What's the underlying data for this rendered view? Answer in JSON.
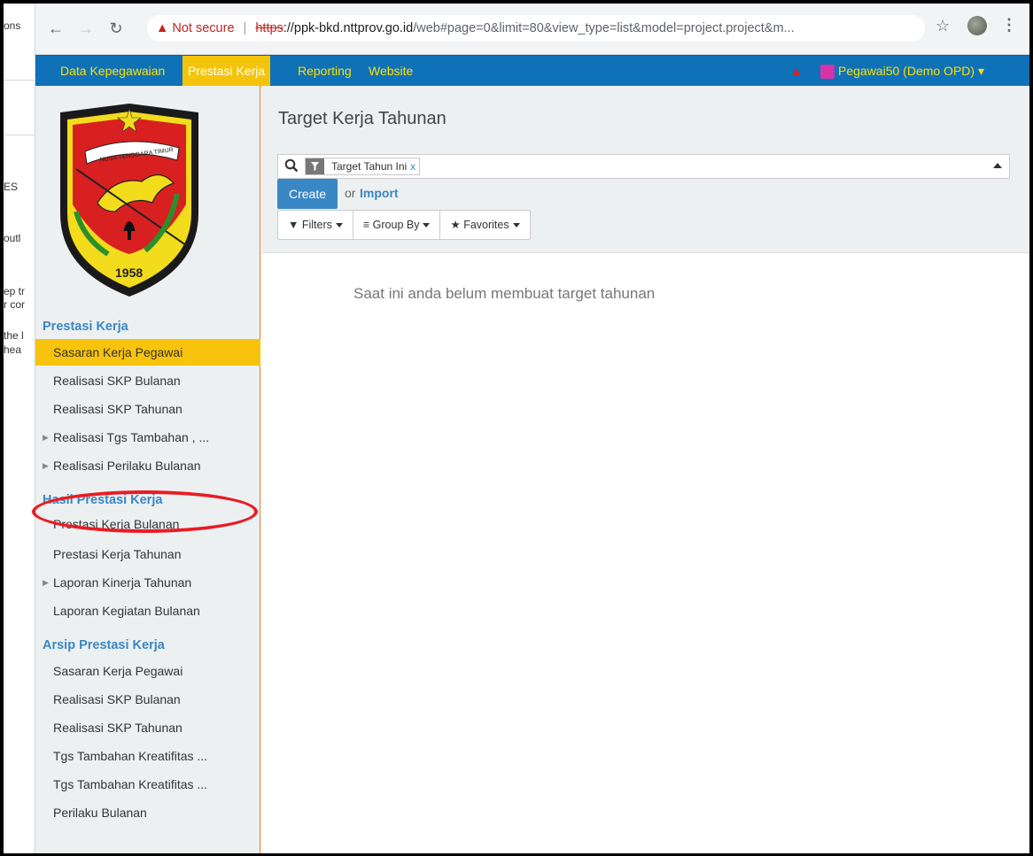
{
  "left_pane": {
    "fragments": [
      "ons",
      "ES",
      "outl",
      "ep tr",
      "r cor",
      "the l",
      "hea"
    ]
  },
  "browser": {
    "security_label": "Not secure",
    "url_scheme": "https",
    "url_host": "://ppk-bkd.nttprov.go.id",
    "url_path": "/web#page=0&limit=80&view_type=list&model=project.project&m..."
  },
  "topnav": {
    "items": [
      "Data Kepegawaian",
      "Prestasi Kerja",
      "Reporting",
      "Website"
    ],
    "active": "Prestasi Kerja",
    "user": "Pegawai50 (Demo OPD)"
  },
  "sidebar": {
    "logo_banner": "NUSA TENGGARA TIMUR",
    "logo_year": "1958",
    "sections": [
      {
        "title": "Prestasi Kerja",
        "items": [
          "Sasaran Kerja Pegawai",
          "Realisasi SKP Bulanan",
          "Realisasi SKP Tahunan",
          "Realisasi Tgs Tambahan , ...",
          "Realisasi Perilaku Bulanan"
        ]
      },
      {
        "title": "Hasil Prestasi Kerja",
        "items": [
          "Prestasi Kerja Bulanan",
          "Prestasi Kerja Tahunan",
          "Laporan Kinerja Tahunan",
          "Laporan Kegiatan Bulanan"
        ]
      },
      {
        "title": "Arsip Prestasi Kerja",
        "items": [
          "Sasaran Kerja Pegawai",
          "Realisasi SKP Bulanan",
          "Realisasi SKP Tahunan",
          "Tgs Tambahan Kreatifitas ...",
          "Tgs Tambahan Kreatifitas ...",
          "Perilaku Bulanan"
        ]
      }
    ]
  },
  "content": {
    "title": "Target Kerja Tahunan",
    "search_facet": "Target Tahun Ini",
    "facet_remove": "x",
    "create_label": "Create",
    "or_label": "or",
    "import_label": "Import",
    "filters_label": "Filters",
    "groupby_label": "Group By",
    "favorites_label": "Favorites",
    "empty_message": "Saat ini anda belum membuat target tahunan"
  },
  "colors": {
    "topnav_bg": "#0f71b8",
    "topnav_text": "#ffe100",
    "active_menu_bg": "#f4c40b",
    "sidebar_active_bg": "#f7c30c",
    "section_title": "#3a87c5",
    "annotation": "#ea1b23"
  }
}
